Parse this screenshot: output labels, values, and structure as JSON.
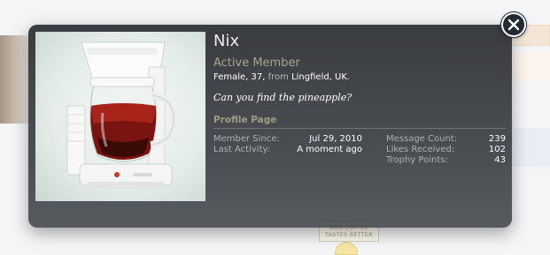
{
  "profile": {
    "username": "Nix",
    "title": "Active Member",
    "gender_age": "Female, 37, ",
    "from_label": "from",
    "location": "Lingfield, UK.",
    "status": "Can you find the pineapple?",
    "section_heading": "Profile Page"
  },
  "stats_left": [
    {
      "label": "Member Since:",
      "value": "Jul 29, 2010"
    },
    {
      "label": "Last Activity:",
      "value": "A moment ago"
    }
  ],
  "stats_right": [
    {
      "label": "Message Count:",
      "value": "239"
    },
    {
      "label": "Likes Received:",
      "value": "102"
    },
    {
      "label": "Trophy Points:",
      "value": "43"
    }
  ],
  "background": {
    "badge_text": "OUR COFFEE TASTES BETTER"
  },
  "icons": {
    "close": "close-icon",
    "photo": "coffee-maker-image"
  },
  "colors": {
    "card_bg": "#2d3136",
    "title_accent": "#aaa48a",
    "link_accent": "#9a9f83"
  }
}
